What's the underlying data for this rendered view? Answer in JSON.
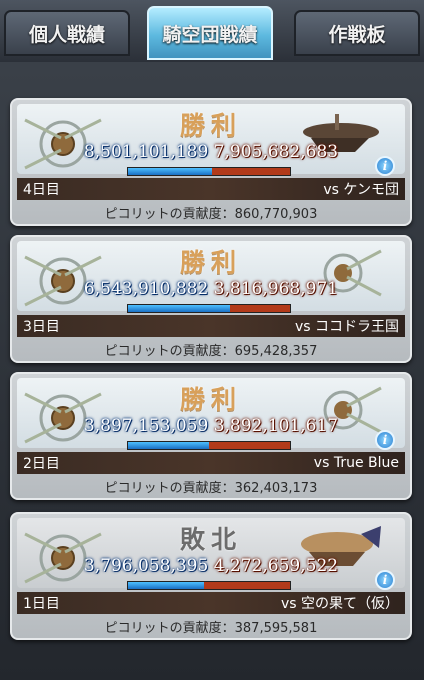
{
  "tabs": [
    {
      "label": "個人戦績",
      "active": false
    },
    {
      "label": "騎空団戦績",
      "active": true
    },
    {
      "label": "作戦板",
      "active": false
    }
  ],
  "colors": {
    "ally_bar": "#1a6fc4",
    "enemy_bar": "#b23a1a",
    "win_text": "#d8a05a",
    "lose_text": "#6c6c6c"
  },
  "cards": [
    {
      "result": "勝利",
      "outcome": "win",
      "our_score": "8,501,101,189",
      "their_score": "7,905,682,683",
      "our_share": 0.518,
      "day": "4日目",
      "opponent": "vs ケンモ団",
      "contribution_label": "ピコリットの貢献度：",
      "contribution": "860,770,903",
      "has_ship": true
    },
    {
      "result": "勝利",
      "outcome": "win",
      "our_score": "6,543,910,882",
      "their_score": "3,816,968,971",
      "our_share": 0.632,
      "day": "3日目",
      "opponent": "vs ココドラ王国",
      "contribution_label": "ピコリットの貢献度：",
      "contribution": "695,428,357",
      "has_ship": false
    },
    {
      "result": "勝利",
      "outcome": "win",
      "our_score": "3,897,153,059",
      "their_score": "3,892,101,617",
      "our_share": 0.5,
      "day": "2日目",
      "opponent": "vs True Blue",
      "contribution_label": "ピコリットの貢献度：",
      "contribution": "362,403,173",
      "has_ship": false
    },
    {
      "result": "敗北",
      "outcome": "lose",
      "our_score": "3,796,058,395",
      "their_score": "4,272,659,522",
      "our_share": 0.47,
      "day": "1日目",
      "opponent": "vs 空の果て（仮）",
      "contribution_label": "ピコリットの貢献度：",
      "contribution": "387,595,581",
      "has_ship": true
    }
  ]
}
